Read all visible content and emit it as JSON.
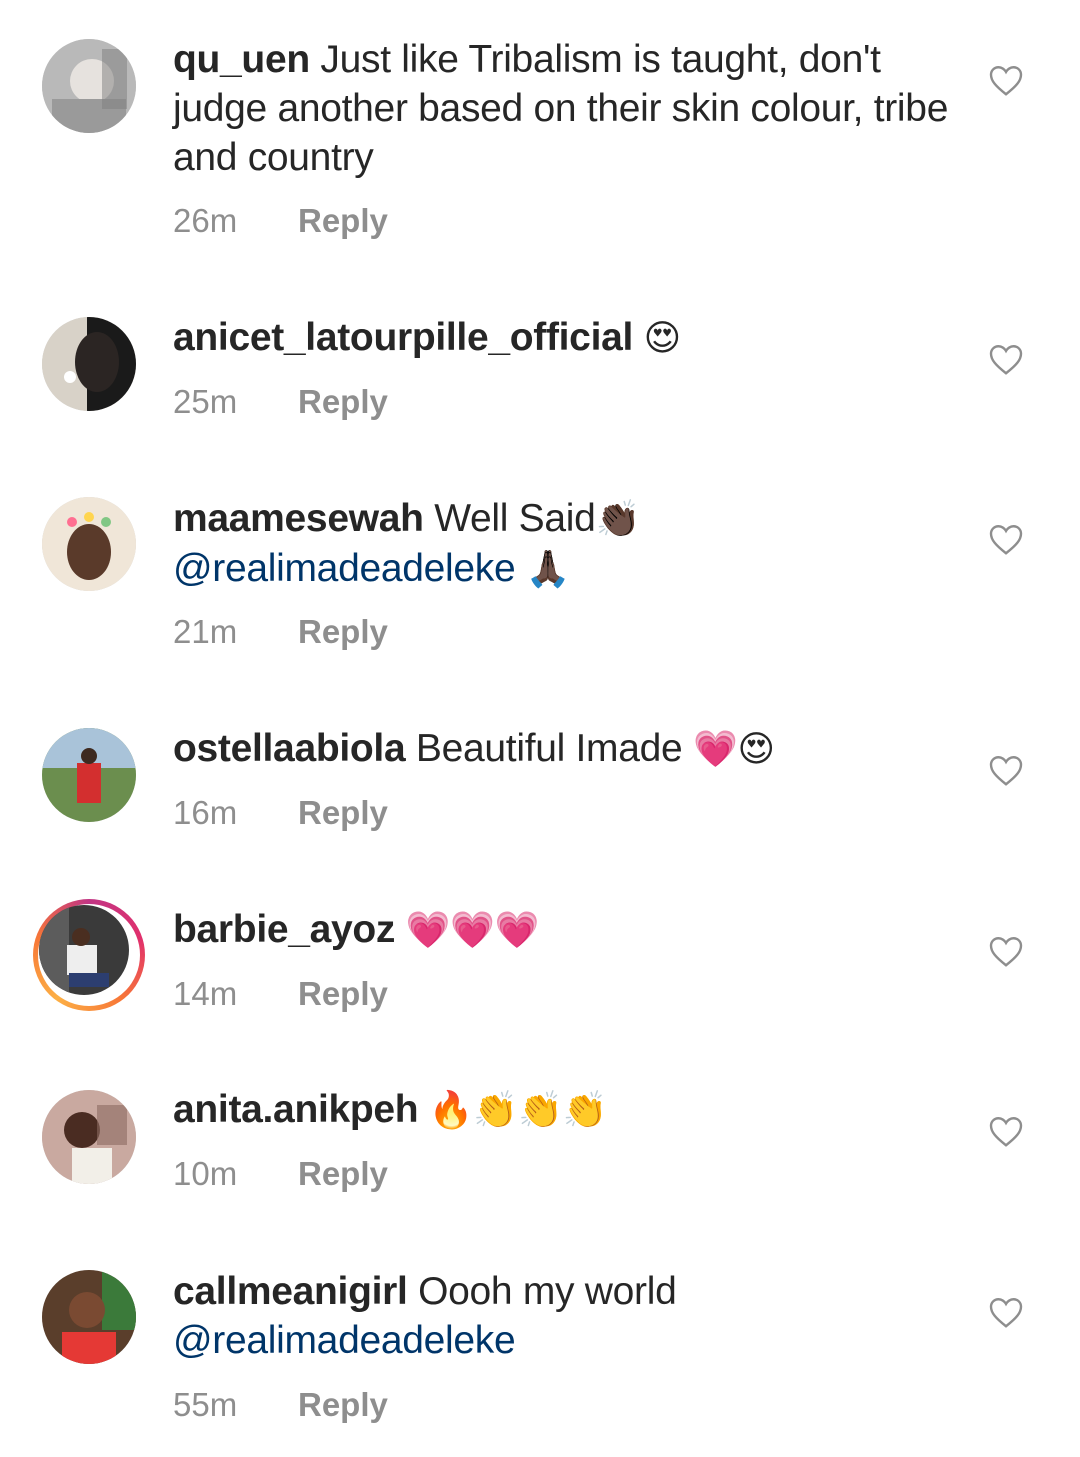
{
  "comments": [
    {
      "username": "qu_uen",
      "text": "Just like Tribalism is taught, don't judge another based on their skin colour, tribe and country",
      "emoji": "",
      "mention": "",
      "time": "26m",
      "reply": "Reply"
    },
    {
      "username": "anicet_latourpille_official",
      "text": "",
      "emoji": "😍",
      "mention": "",
      "time": "25m",
      "reply": "Reply"
    },
    {
      "username": "maamesewah",
      "text": "Well Said",
      "emoji": "👏🏿",
      "mention": "@realimadeadeleke",
      "mention_emoji": "🙏🏿",
      "time": "21m",
      "reply": "Reply"
    },
    {
      "username": "ostellaabiola",
      "text": "Beautiful Imade",
      "emoji": "💗😍",
      "mention": "",
      "time": "16m",
      "reply": "Reply"
    },
    {
      "username": "barbie_ayoz",
      "text": "",
      "emoji": "💗💗💗",
      "mention": "",
      "time": "14m",
      "reply": "Reply"
    },
    {
      "username": "anita.anikpeh",
      "text": "",
      "emoji": "🔥👏👏👏",
      "mention": "",
      "time": "10m",
      "reply": "Reply"
    },
    {
      "username": "callmeanigirl",
      "text": "Oooh my world",
      "emoji": "",
      "mention": "@realimadeadeleke",
      "time": "55m",
      "reply": "Reply"
    }
  ],
  "icons": {
    "like": "heart-outline-icon"
  },
  "colors": {
    "text": "#262626",
    "meta": "#8e8e8e",
    "mention": "#003569"
  }
}
